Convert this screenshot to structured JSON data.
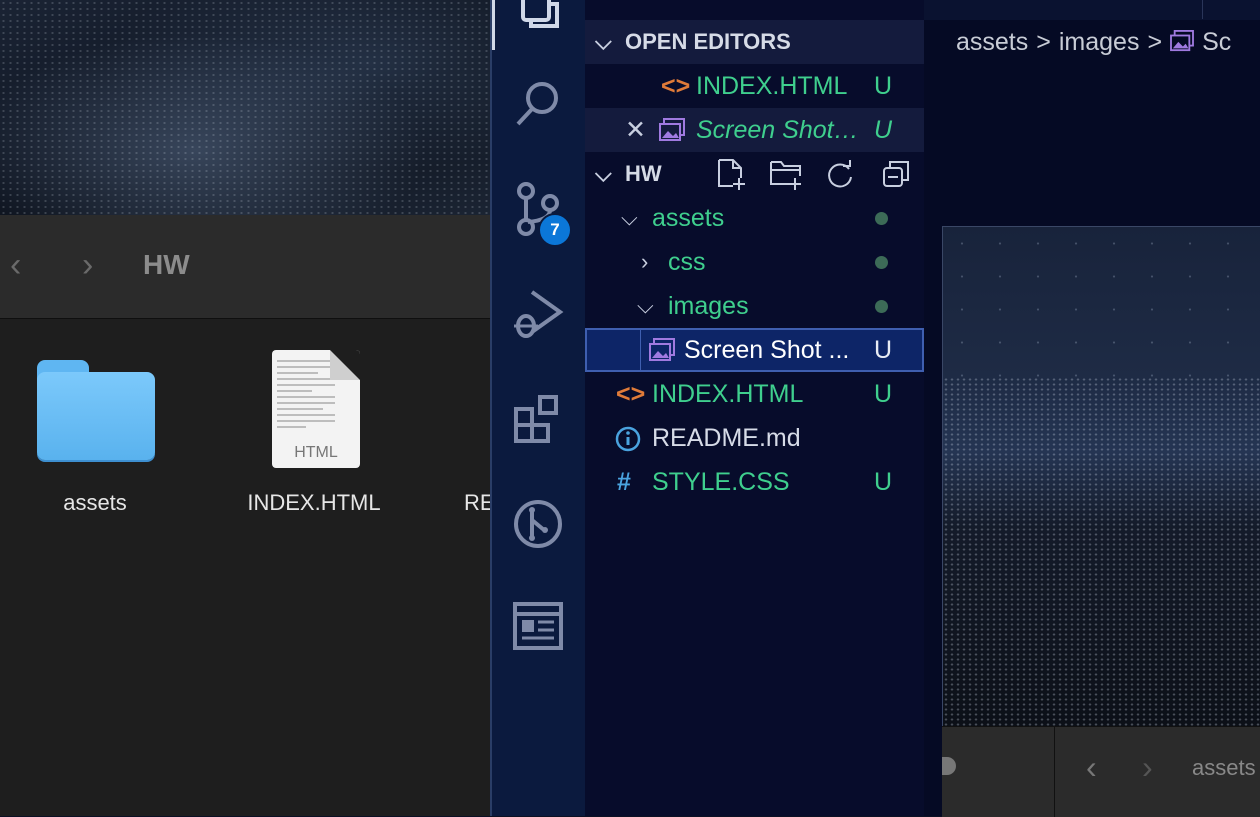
{
  "finder": {
    "title": "HW",
    "back": "‹",
    "forward": "›",
    "items": [
      {
        "label": "assets",
        "icon": "folder-icon"
      },
      {
        "label": "INDEX.HTML",
        "icon": "html-file-icon",
        "badge": "HTML"
      },
      {
        "label": "RE",
        "icon": "file-icon"
      }
    ]
  },
  "activity_bar": {
    "source_control_badge": "7",
    "items": [
      "explorer-icon",
      "search-icon",
      "source-control-icon",
      "run-debug-icon",
      "extensions-icon",
      "git-graph-icon",
      "browser-preview-icon"
    ]
  },
  "explorer": {
    "open_editors_title": "OPEN EDITORS",
    "open_editors": [
      {
        "label": "INDEX.HTML",
        "status": "U"
      },
      {
        "label": "Screen Shot…",
        "status": "U"
      }
    ],
    "folder_title": "HW",
    "tree": [
      {
        "label": "assets"
      },
      {
        "label": "css"
      },
      {
        "label": "images"
      },
      {
        "label": "Screen Shot ...",
        "status": "U"
      },
      {
        "label": "INDEX.HTML",
        "status": "U"
      },
      {
        "label": "README.md"
      },
      {
        "label": "STYLE.CSS",
        "status": "U"
      }
    ]
  },
  "editor": {
    "breadcrumb": [
      "assets",
      ">",
      "images",
      ">",
      "Sc"
    ],
    "bottom_text": "assets",
    "bottom_back": "‹",
    "bottom_forward": "›"
  },
  "colors": {
    "accent_green": "#3fcf8e",
    "badge_blue": "#0b77d8",
    "activity_bg": "#0b1a3e",
    "explorer_bg": "#070c2b"
  }
}
